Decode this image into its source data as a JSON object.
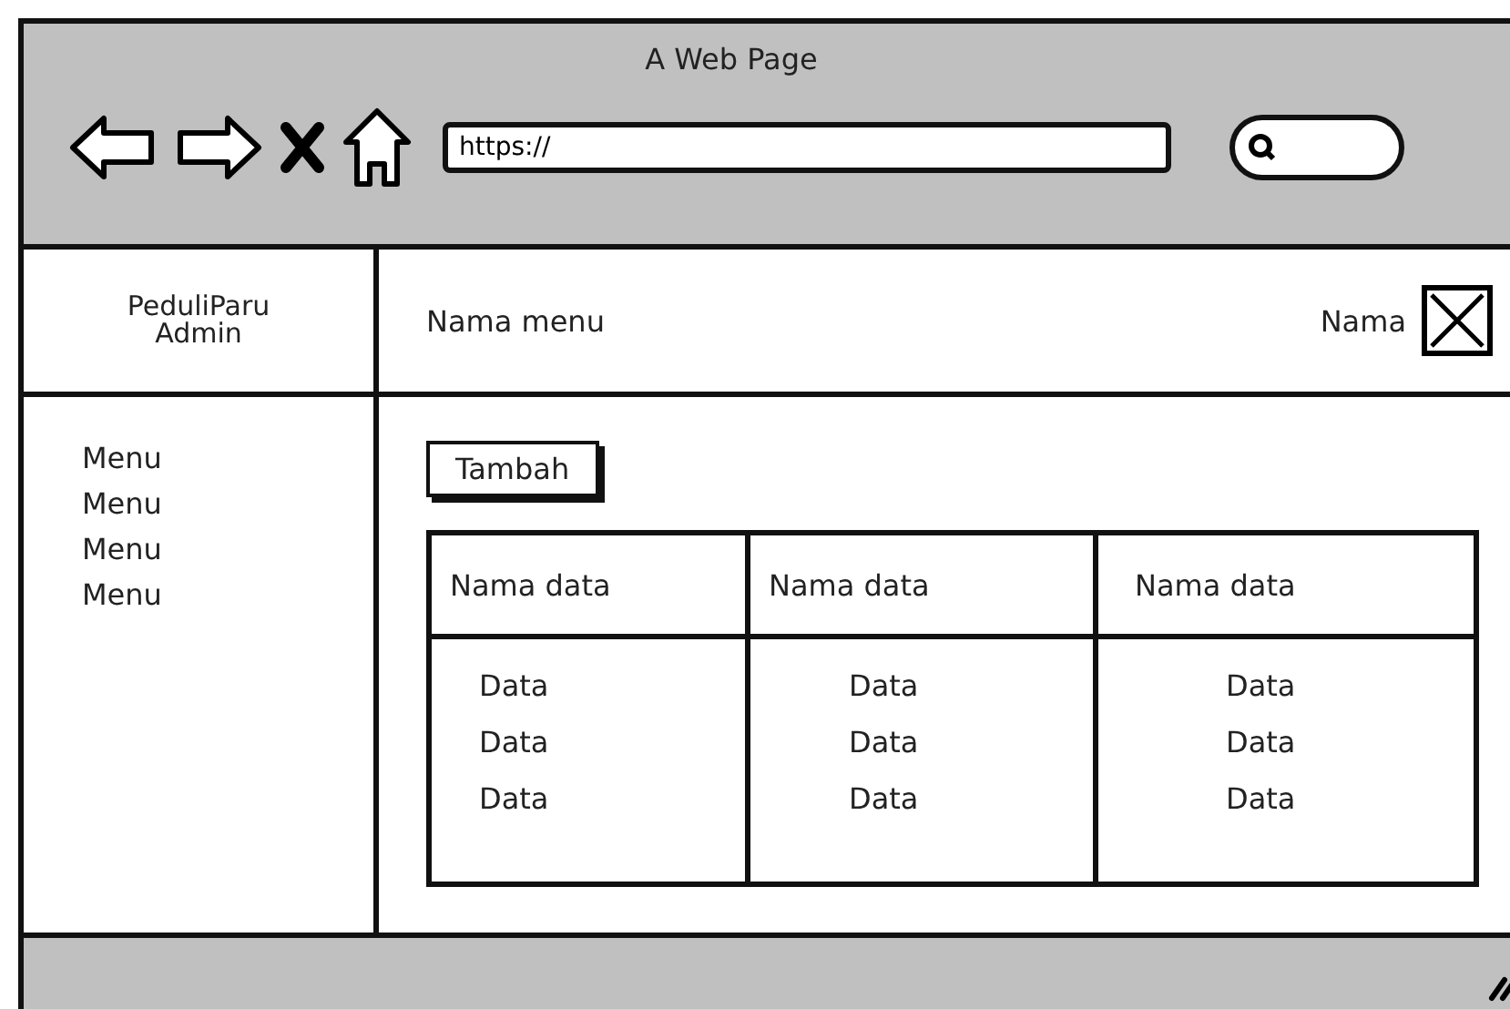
{
  "window": {
    "title": "A Web Page"
  },
  "address_bar": {
    "value": "https://"
  },
  "sidebar": {
    "brand": [
      "PeduliParu",
      "Admin"
    ],
    "items": [
      "Menu",
      "Menu",
      "Menu",
      "Menu"
    ]
  },
  "header": {
    "title": "Nama menu",
    "user": "Nama"
  },
  "add_button": "Tambah",
  "table": {
    "columns": [
      "Nama data",
      "Nama data",
      "Nama data"
    ],
    "rows": [
      [
        "Data",
        "Data",
        "Data"
      ],
      [
        "Data",
        "Data",
        "Data"
      ],
      [
        "Data",
        "Data",
        "Data"
      ]
    ]
  }
}
